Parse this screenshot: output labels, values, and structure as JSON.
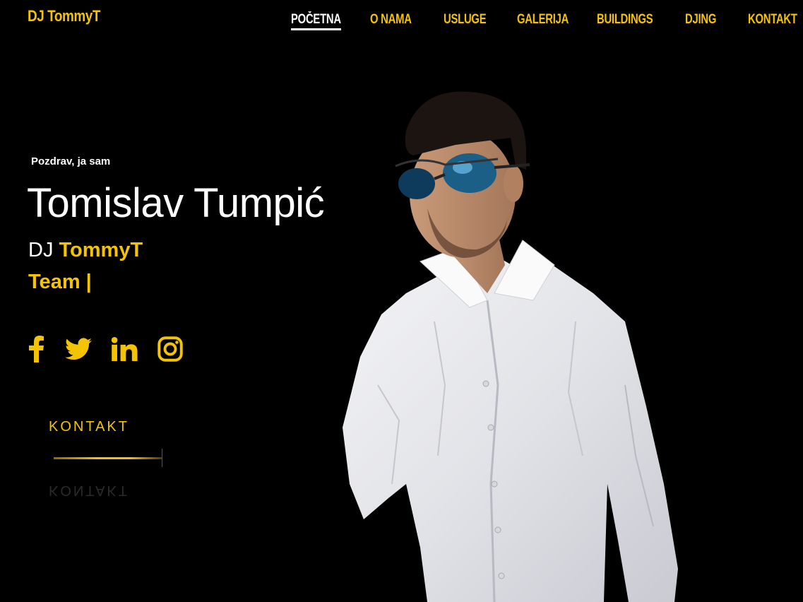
{
  "site": {
    "logo": "DJ TommyT"
  },
  "nav": [
    {
      "label": "POČETNA",
      "active": true
    },
    {
      "label": "O NAMA"
    },
    {
      "label": "USLUGE"
    },
    {
      "label": "GALERIJA"
    },
    {
      "label": "BUILDINGS"
    },
    {
      "label": "DJING"
    },
    {
      "label": "KONTAKT"
    }
  ],
  "hero": {
    "greeting": "Pozdrav, ja sam",
    "name": "Tomislav Tumpić",
    "role_prefix": "DJ ",
    "role_highlight": "TommyT",
    "role_line2": "Team |",
    "cta_label": "KONTAKT"
  },
  "socials": [
    {
      "icon": "facebook-icon"
    },
    {
      "icon": "twitter-icon"
    },
    {
      "icon": "linkedin-icon"
    },
    {
      "icon": "instagram-icon"
    }
  ],
  "colors": {
    "accent": "#f5c400",
    "background": "#000000",
    "text": "#ffffff"
  }
}
